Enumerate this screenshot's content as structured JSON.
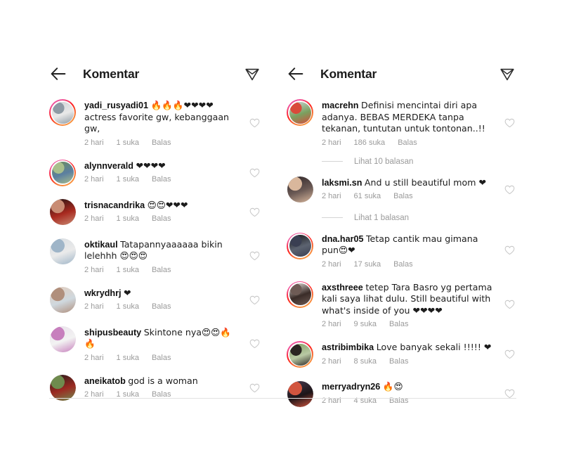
{
  "app": {
    "background_color": "#ffffff",
    "accent_ring_colors": [
      "#e1306c",
      "#fd1d1d",
      "#f77737",
      "#fcaf45"
    ]
  },
  "panels": [
    {
      "id": "left-panel",
      "header": {
        "title": "Komentar",
        "back_icon": "arrow-left-icon",
        "send_icon": "paper-plane-icon"
      },
      "comments": [
        {
          "username": "yadi_rusyadi01",
          "text": "🔥🔥🔥❤❤❤❤actress favorite gw, kebanggaan gw,",
          "time": "2 hari",
          "likes": "1 suka",
          "reply": "Balas",
          "avatar_ring": true,
          "avatar_colors": [
            "#cfd3d6",
            "#8d9aa4",
            "#e8e8e8"
          ]
        },
        {
          "username": "alynnverald",
          "text": "❤❤❤❤",
          "time": "2 hari",
          "likes": "1 suka",
          "reply": "Balas",
          "avatar_ring": true,
          "avatar_colors": [
            "#6f8f5a",
            "#a8bf8c",
            "#5b7fa0"
          ]
        },
        {
          "username": "trisnacandrika",
          "text": "😍😍❤❤❤",
          "time": "2 hari",
          "likes": "1 suka",
          "reply": "Balas",
          "avatar_ring": false,
          "avatar_colors": [
            "#1b1414",
            "#c98c74",
            "#a8291f"
          ]
        },
        {
          "username": "oktikaul",
          "text": "Tatapannyaaaaaa bikin lelehhh 😍😍😍",
          "time": "2 hari",
          "likes": "1 suka",
          "reply": "Balas",
          "avatar_ring": false,
          "avatar_colors": [
            "#d7dde2",
            "#9fb5c8",
            "#eaeaea"
          ]
        },
        {
          "username": "wkrydhrj",
          "text": "❤",
          "time": "2 hari",
          "likes": "1 suka",
          "reply": "Balas",
          "avatar_ring": false,
          "avatar_colors": [
            "#e4cdbd",
            "#b08f7c",
            "#cfd8de"
          ]
        },
        {
          "username": "shipusbeauty",
          "text": "Skintone nya😍😍🔥🔥",
          "time": "2 hari",
          "likes": "1 suka",
          "reply": "Balas",
          "avatar_ring": false,
          "avatar_colors": [
            "#e9e0ea",
            "#c77fbd",
            "#f2f2f2"
          ]
        },
        {
          "username": "aneikatob",
          "text": "god is a woman",
          "time": "2 hari",
          "likes": "1 suka",
          "reply": "Balas",
          "avatar_ring": false,
          "avatar_colors": [
            "#1d1a1a",
            "#6f8b4e",
            "#9c2a22"
          ]
        }
      ]
    },
    {
      "id": "right-panel",
      "header": {
        "title": "Komentar",
        "back_icon": "arrow-left-icon",
        "send_icon": "paper-plane-icon"
      },
      "comments": [
        {
          "username": "macrehn",
          "text": "Definisi mencintai diri apa adanya. BEBAS MERDEKA tanpa tekanan, tuntutan untuk tontonan..!!",
          "time": "2 hari",
          "likes": "186 suka",
          "reply": "Balas",
          "avatar_ring": true,
          "avatar_colors": [
            "#cfd5d8",
            "#d94a3a",
            "#7aa05f"
          ],
          "replies_label": "Lihat 10 balasan"
        },
        {
          "username": "laksmi.sn",
          "text": "And u still beautiful mom ❤",
          "time": "2 hari",
          "likes": "61 suka",
          "reply": "Balas",
          "avatar_ring": false,
          "avatar_colors": [
            "#2b2326",
            "#d9b79c",
            "#6b5a55"
          ],
          "replies_label": "Lihat 1 balasan"
        },
        {
          "username": "dna.har05",
          "text": "Tetap cantik mau gimana pun😍❤",
          "time": "2 hari",
          "likes": "17 suka",
          "reply": "Balas",
          "avatar_ring": true,
          "avatar_colors": [
            "#141414",
            "#3a3f52",
            "#5c6370"
          ]
        },
        {
          "username": "axsthreee",
          "text": "tetep Tara Basro yg pertama kali saya lihat dulu. Still beautiful with what's inside of you ❤❤❤❤",
          "time": "2 hari",
          "likes": "9 suka",
          "reply": "Balas",
          "avatar_ring": true,
          "avatar_colors": [
            "#e8e3df",
            "#6e5b55",
            "#3a2c28"
          ]
        },
        {
          "username": "astribimbika",
          "text": "Love banyak sekali !!!!! ❤",
          "time": "2 hari",
          "likes": "8 suka",
          "reply": "Balas",
          "avatar_ring": true,
          "avatar_colors": [
            "#7c9a5e",
            "#2a2522",
            "#b9c9a4"
          ]
        },
        {
          "username": "merryadryn26",
          "text": "🔥😍",
          "time": "2 hari",
          "likes": "4 suka",
          "reply": "Balas",
          "avatar_ring": false,
          "avatar_colors": [
            "#4a3c52",
            "#d2553f",
            "#1d1518"
          ]
        }
      ]
    }
  ]
}
